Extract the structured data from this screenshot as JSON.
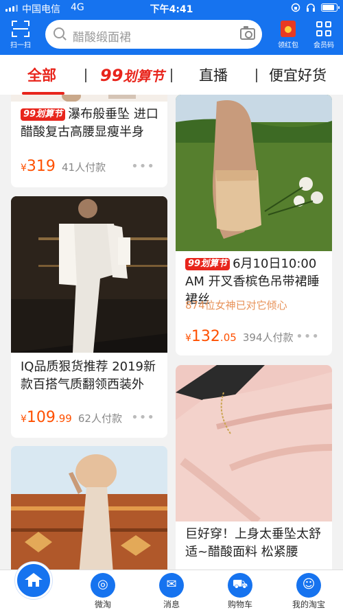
{
  "status_bar": {
    "carrier": "中国电信",
    "network": "4G",
    "time": "下午4:41",
    "battery_level": 0.9
  },
  "header": {
    "scan_label": "扫一扫",
    "search_placeholder": "醋酸缎面裙",
    "redpacket_label": "领红包",
    "member_label": "会员码"
  },
  "tabs": {
    "all": "全部",
    "festival_num": "99",
    "festival_text": "划算节",
    "live": "直播",
    "cheap": "便宜好货"
  },
  "tag_99": "99划算节",
  "products": [
    {
      "title": "瀑布般垂坠 进口醋酸复古高腰显瘦半身",
      "has_tag": true,
      "price_int": "319",
      "price_dec": "",
      "payers": "41人付款",
      "image": "satin-skirt-photo"
    },
    {
      "title": "IQ品质狠货推荐 2019新款百搭气质翻领西装外",
      "has_tag": false,
      "price_int": "109",
      "price_dec": ".99",
      "payers": "62人付款",
      "image": "white-blazer-dress-photo"
    },
    {
      "title": "",
      "has_tag": false,
      "image": "straw-hat-champagne-dress-photo"
    },
    {
      "title": "6月10日10:00 AM 开叉香槟色吊带裙睡裙丝",
      "has_tag": true,
      "subtitle": "874位女神已对它倾心",
      "price_int": "132",
      "price_dec": ".05",
      "payers": "394人付款",
      "image": "champagne-slip-dress-photo"
    },
    {
      "title": "巨好穿！上身太垂坠太舒适~醋酸面料 松紧腰",
      "has_tag": false,
      "image": "pink-satin-fabric-photo"
    }
  ],
  "currency": "¥",
  "more_glyph": "•••",
  "bottom_nav": {
    "weitao": "微淘",
    "messages": "消息",
    "cart": "购物车",
    "mytaobao": "我的淘宝"
  },
  "colors": {
    "brand_blue": "#1673ef",
    "accent_red": "#e8251c",
    "price_orange": "#ff5000"
  }
}
